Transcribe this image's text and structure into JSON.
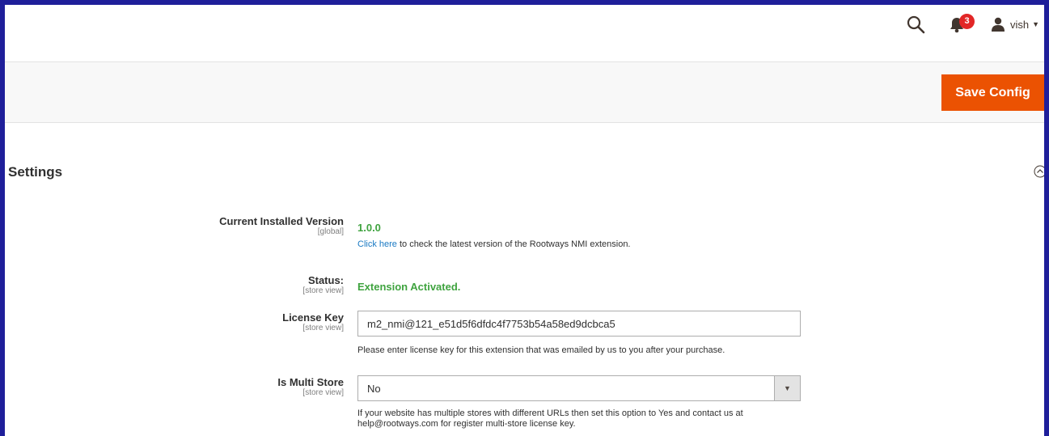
{
  "header": {
    "badge_count": "3",
    "user_name": "vish",
    "icons": [
      "search-icon",
      "bell-icon",
      "user-icon",
      "caret-down-icon"
    ]
  },
  "actions": {
    "save_label": "Save Config",
    "accent_color": "#eb5202"
  },
  "section": {
    "title": "Settings"
  },
  "fields": {
    "version": {
      "label": "Current Installed Version",
      "scope": "[global]",
      "value": "1.0.0",
      "link_text": "Click here",
      "link_suffix": " to check the latest version of the Rootways NMI extension."
    },
    "status": {
      "label": "Status:",
      "scope": "[store view]",
      "value": "Extension Activated."
    },
    "license": {
      "label": "License Key",
      "scope": "[store view]",
      "value": "m2_nmi@121_e51d5f6dfdc4f7753b54a58ed9dcbca5",
      "note": "Please enter license key for this extension that was emailed by us to you after your purchase."
    },
    "multistore": {
      "label": "Is Multi Store",
      "scope": "[store view]",
      "selected": "No",
      "note_line1": "If your website has multiple stores with different URLs then set this option to Yes and contact us at",
      "note_line2": "help@rootways.com for register multi-store license key."
    }
  },
  "colors": {
    "frame": "#1f1f9a",
    "success": "#3fa33f",
    "link": "#1979c3",
    "badge": "#e22626"
  }
}
